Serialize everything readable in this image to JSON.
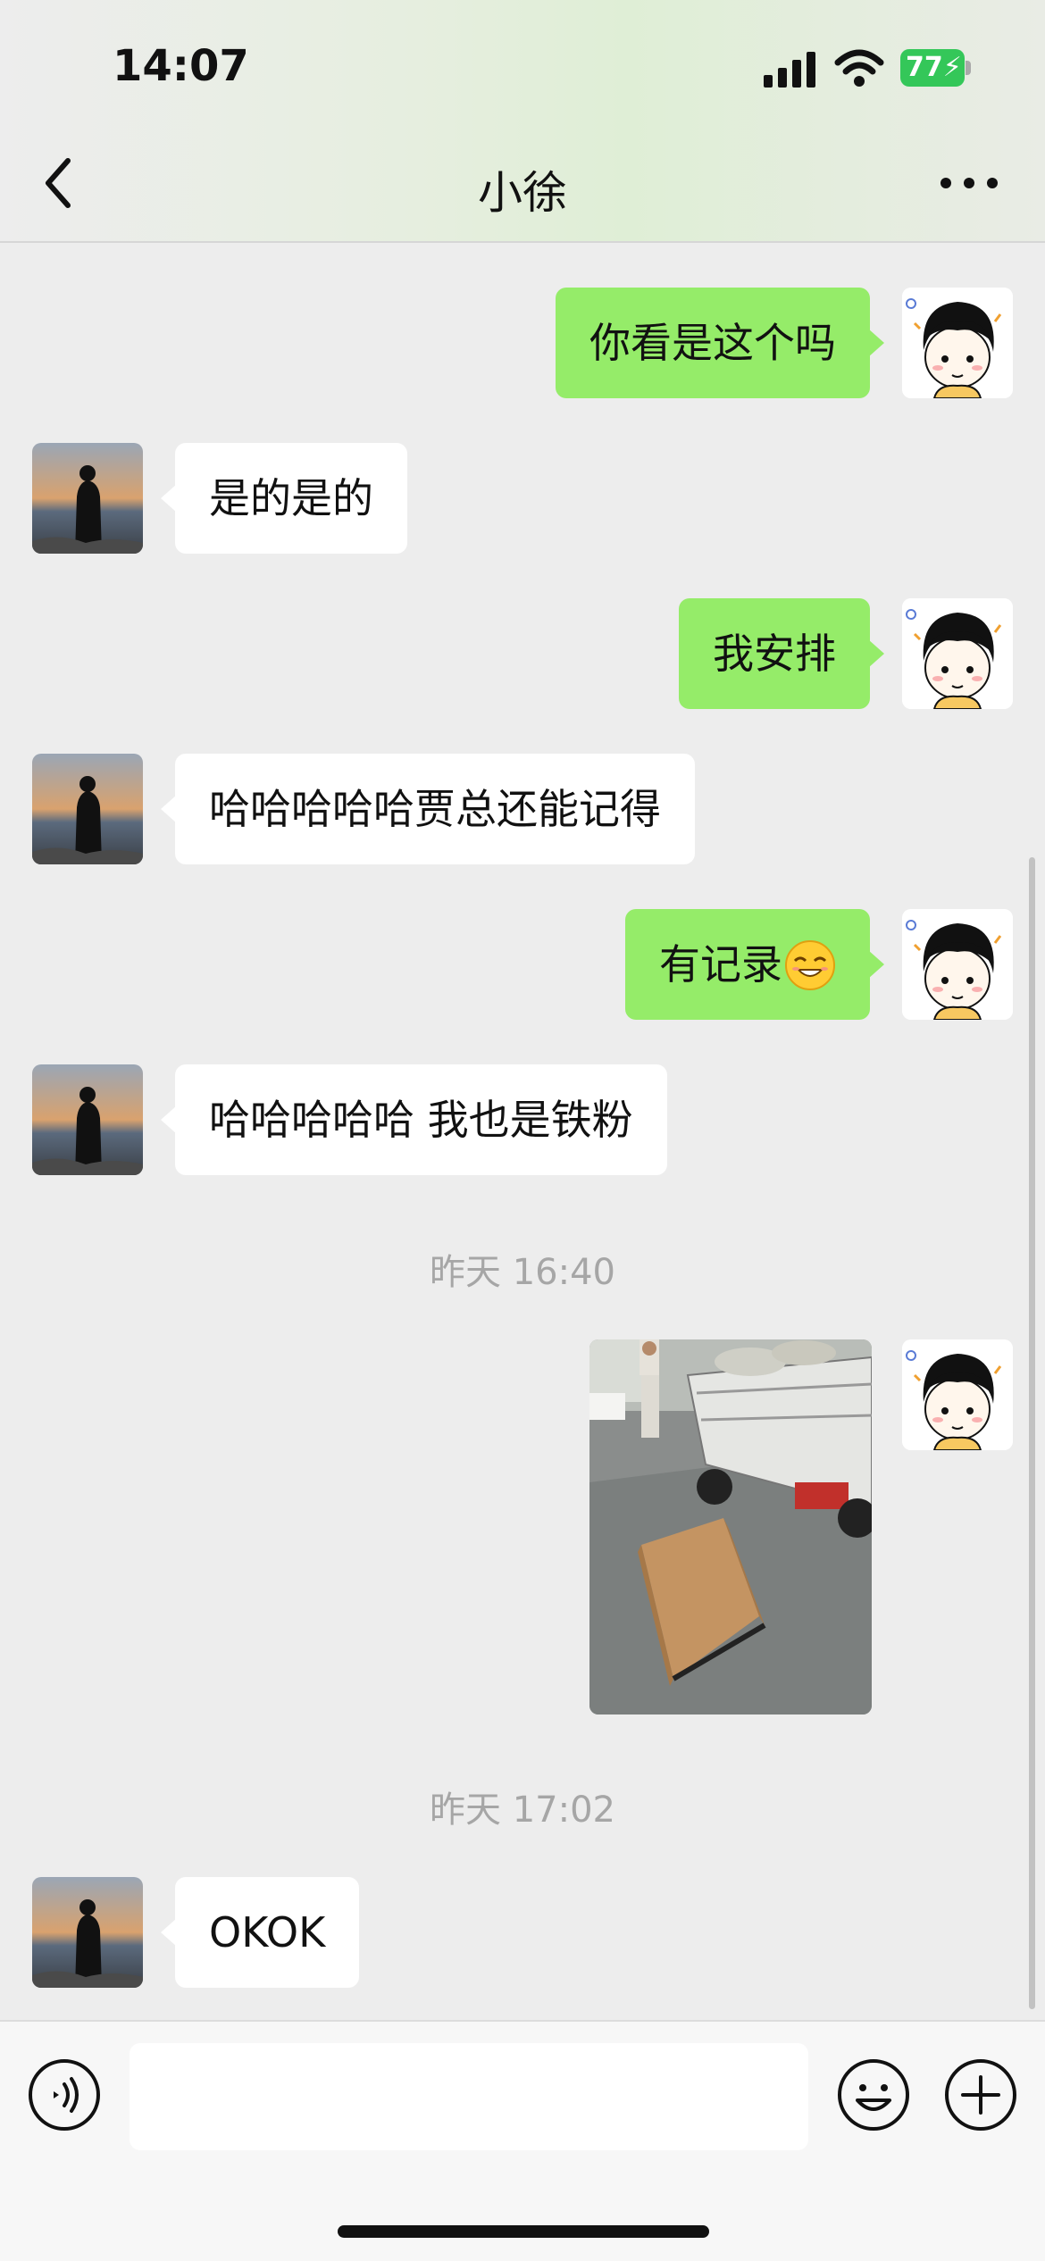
{
  "status_bar": {
    "time": "14:07",
    "battery": "77"
  },
  "nav": {
    "title": "小徐",
    "back_icon": "chevron-left-icon",
    "more_icon": "ellipsis-icon"
  },
  "messages": [
    {
      "from": "self",
      "text": "你看是这个吗"
    },
    {
      "from": "other",
      "text": "是的是的"
    },
    {
      "from": "self",
      "text": "我安排"
    },
    {
      "from": "other",
      "text": "哈哈哈哈哈贾总还能记得"
    },
    {
      "from": "self",
      "text": "有记录",
      "emoji": "grin-emoji-icon"
    },
    {
      "from": "other",
      "text": "哈哈哈哈哈 我也是铁粉"
    },
    {
      "timestamp": "昨天 16:40"
    },
    {
      "from": "self",
      "type": "image",
      "content": "photo-truck-box"
    },
    {
      "timestamp": "昨天 17:02"
    },
    {
      "from": "other",
      "text": "OKOK"
    }
  ],
  "input_bar": {
    "voice_icon": "voice-icon",
    "emoji_icon": "smiley-icon",
    "plus_icon": "plus-circle-icon",
    "text_value": ""
  },
  "colors": {
    "outgoing_bubble": "#95ec69",
    "incoming_bubble": "#ffffff",
    "background": "#ededed",
    "battery": "#34c759"
  }
}
